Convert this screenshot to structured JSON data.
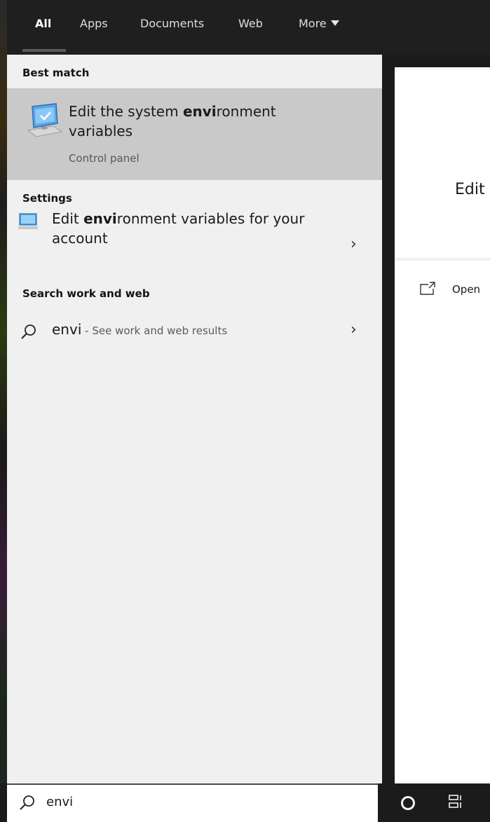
{
  "tabs": [
    {
      "label": "All",
      "active": true
    },
    {
      "label": "Apps",
      "active": false
    },
    {
      "label": "Documents",
      "active": false
    },
    {
      "label": "Web",
      "active": false
    },
    {
      "label": "More",
      "active": false
    }
  ],
  "best_match": {
    "header": "Best match",
    "title_prefix": "Edit the system ",
    "title_bold": "envi",
    "title_suffix": "ronment variables",
    "subtitle": "Control panel",
    "icon": "monitor-checkmark-icon"
  },
  "settings": {
    "header": "Settings",
    "item": {
      "prefix": "Edit ",
      "bold": "envi",
      "suffix": "ronment variables for your account",
      "icon": "monitor-icon"
    }
  },
  "web": {
    "header": "Search work and web",
    "query": "envi",
    "hint": " - See work and web results",
    "icon": "search-icon"
  },
  "detail": {
    "title": "Edit",
    "open_label": "Open",
    "open_icon": "open-window-icon"
  },
  "search": {
    "value": "envi",
    "icon": "search-icon"
  },
  "taskbar": {
    "cortana_icon": "cortana-circle-icon",
    "taskview_icon": "task-view-icon"
  },
  "colors": {
    "topbar": "#1f1f1f",
    "results_bg": "#f0f0f0",
    "selected_row": "#c9c9c9",
    "accent_blue": "#1e88e5"
  }
}
